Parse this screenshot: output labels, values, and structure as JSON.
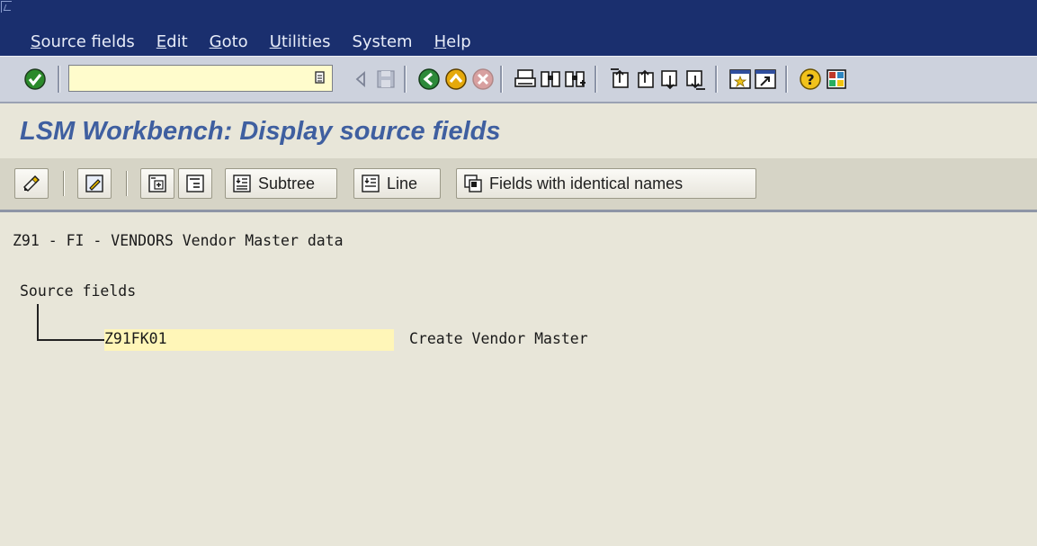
{
  "menubar": {
    "items": [
      {
        "underline": "S",
        "rest": "ource fields"
      },
      {
        "underline": "E",
        "rest": "dit"
      },
      {
        "underline": "G",
        "rest": "oto"
      },
      {
        "underline": "U",
        "rest": "tilities"
      },
      {
        "underline": "",
        "rest": "System"
      },
      {
        "underline": "H",
        "rest": "elp"
      }
    ]
  },
  "toolbar": {
    "command_field_value": "",
    "icons": [
      "enter-icon",
      "command-dropdown-icon",
      "back-arrow-icon",
      "save-icon",
      "back-icon",
      "exit-icon",
      "cancel-icon",
      "print-icon",
      "find-icon",
      "find-next-icon",
      "first-page-icon",
      "previous-page-icon",
      "next-page-icon",
      "last-page-icon",
      "create-session-icon",
      "create-shortcut-icon",
      "help-icon",
      "layout-menu-icon"
    ]
  },
  "page": {
    "title": "LSM Workbench: Display source fields"
  },
  "app_toolbar": {
    "subtree_label": "Subtree",
    "line_label": "Line",
    "identical_names_label": "Fields with identical names"
  },
  "content": {
    "object_title": "Z91 - FI - VENDORS Vendor Master data",
    "root_label": "Source fields",
    "node_id": "Z91FK01",
    "node_desc": "Create Vendor Master"
  },
  "colors": {
    "menubar_bg": "#1a2f6e",
    "title_color": "#3f5fa0",
    "field_highlight": "#fff6b8",
    "background": "#e8e6d9"
  }
}
